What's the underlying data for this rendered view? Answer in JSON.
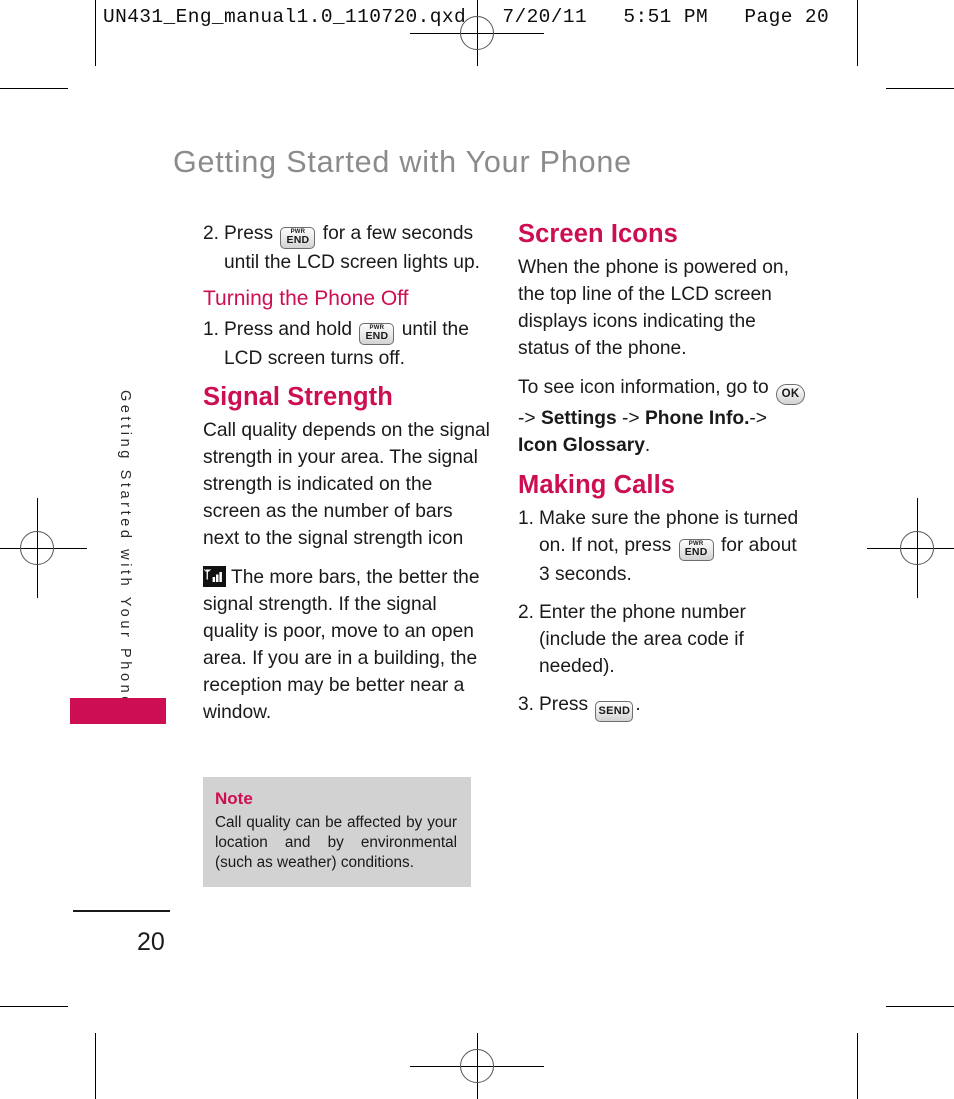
{
  "prepress": {
    "header_line": "UN431_Eng_manual1.0_110720.qxd   7/20/11   5:51 PM   Page 20"
  },
  "page": {
    "title": "Getting Started with Your Phone",
    "side_tab_label": "Getting Started with Your Phone",
    "page_number": "20",
    "accent_color": "#cd0e52",
    "title_color": "#8b8b8b"
  },
  "left_column": {
    "step2": {
      "num": "2.",
      "text_before": "Press",
      "key": "pwr-end-key",
      "text_after": "for a few seconds until the LCD screen lights up."
    },
    "turning_off": {
      "heading": "Turning the Phone Off",
      "step1": {
        "num": "1.",
        "text_before": "Press and hold",
        "key": "pwr-end-key",
        "text_after": "until the LCD screen turns off."
      }
    },
    "signal_strength": {
      "heading": "Signal Strength",
      "para1": "Call quality depends on the signal strength in your area. The signal strength is indicated on the screen as the number of bars next to the signal strength icon",
      "icon": "signal-bars-icon",
      "para2": "The more bars, the better the signal strength. If the signal quality is poor, move to an open area. If you are in a building, the reception may be better near a window."
    },
    "note": {
      "title": "Note",
      "text": "Call quality can be affected by your location and by environmental (such as weather) conditions."
    }
  },
  "right_column": {
    "screen_icons": {
      "heading": "Screen Icons",
      "para1": "When the phone is powered on, the top line of the LCD screen displays icons indicating the status of the phone.",
      "para2_before": "To see icon information, go to",
      "ok_key": "ok-key",
      "nav_arrow1": "->",
      "nav_item1": "Settings",
      "nav_arrow2": "->",
      "nav_item2": "Phone Info.",
      "nav_arrow3": "->",
      "nav_item3": "Icon Glossary",
      "period": "."
    },
    "making_calls": {
      "heading": "Making Calls",
      "steps": [
        {
          "num": "1.",
          "text_before": "Make sure the phone is turned on. If not, press",
          "key": "pwr-end-key",
          "text_after": "for about 3 seconds."
        },
        {
          "num": "2.",
          "text_before": "Enter the phone number (include the area code if needed).",
          "key": "",
          "text_after": ""
        },
        {
          "num": "3.",
          "text_before": "Press",
          "key": "send-key",
          "text_after": "."
        }
      ]
    }
  },
  "keys": {
    "pwr_top": "PWR",
    "pwr_bottom": "END",
    "send": "SEND",
    "ok": "OK"
  }
}
